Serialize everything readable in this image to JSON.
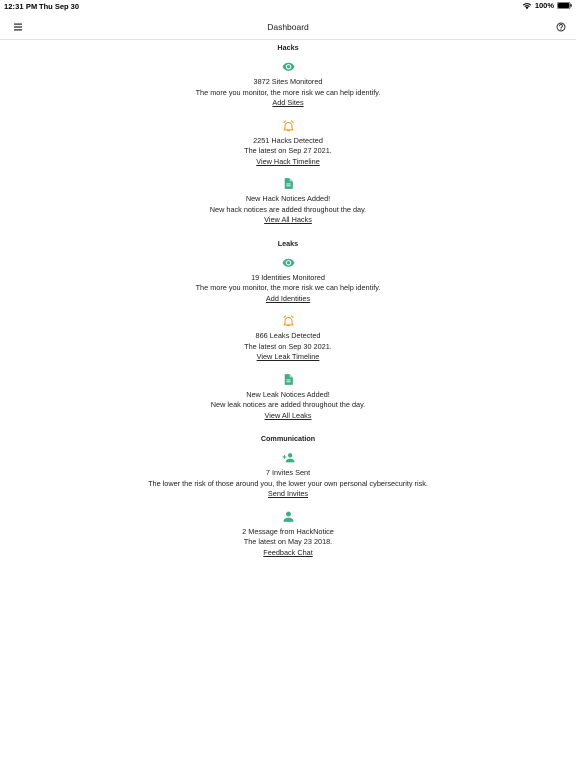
{
  "status_bar": {
    "time": "12:31 PM",
    "date": "Thu Sep 30",
    "battery": "100%"
  },
  "nav": {
    "title": "Dashboard"
  },
  "sections": [
    {
      "title": "Hacks",
      "cards": [
        {
          "icon": "eye-icon",
          "line1": "3872 Sites Monitored",
          "line2": "The more you monitor, the more risk we can help identify.",
          "link": "Add Sites"
        },
        {
          "icon": "alarm-icon",
          "line1": "2251 Hacks Detected",
          "line2": "The latest on Sep 27 2021.",
          "link": "View Hack Timeline"
        },
        {
          "icon": "document-icon",
          "line1": "New Hack Notices Added!",
          "line2": "New hack notices are added throughout the day.",
          "link": "View All Hacks"
        }
      ]
    },
    {
      "title": "Leaks",
      "cards": [
        {
          "icon": "eye-icon",
          "line1": "19 Identities Monitored",
          "line2": "The more you monitor, the more risk we can help identify.",
          "link": "Add Identities"
        },
        {
          "icon": "alarm-icon",
          "line1": "866 Leaks Detected",
          "line2": "The latest on Sep 30 2021.",
          "link": "View Leak Timeline"
        },
        {
          "icon": "document-icon",
          "line1": "New Leak Notices Added!",
          "line2": "New leak notices are added throughout the day.",
          "link": "View All Leaks"
        }
      ]
    },
    {
      "title": "Communication",
      "cards": [
        {
          "icon": "add-person-icon",
          "line1": "7 Invites Sent",
          "line2": "The lower the risk of those around you, the lower your own personal cybersecurity risk.",
          "link": "Send Invites"
        },
        {
          "icon": "person-icon",
          "line1": "2 Message from HackNotice",
          "line2": "The latest on May 23 2018.",
          "link": "Feedback Chat"
        }
      ]
    }
  ],
  "colors": {
    "green": "#3fae85",
    "orange": "#f0921e"
  }
}
